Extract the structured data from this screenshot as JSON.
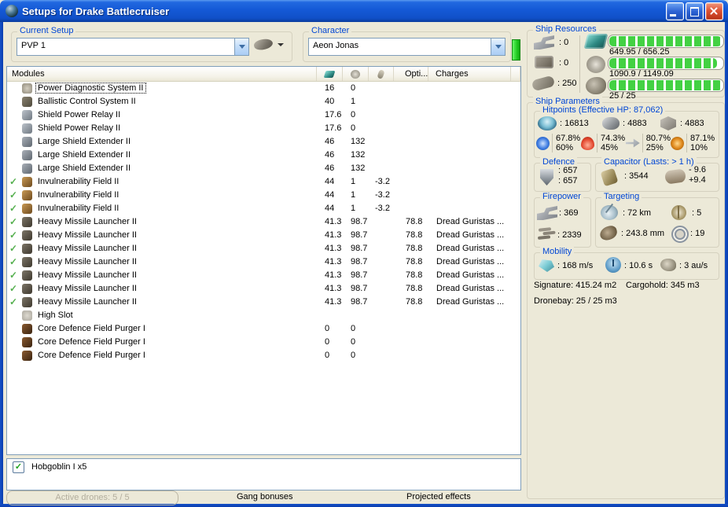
{
  "window": {
    "title": "Setups for Drake Battlecruiser"
  },
  "setup": {
    "label": "Current Setup",
    "value": "PVP 1"
  },
  "character": {
    "label": "Character",
    "value": "Aeon Jonas"
  },
  "ship_resources": {
    "label": "Ship Resources",
    "turret_hardpoints": ": 0",
    "launcher_hardpoints": ": 0",
    "calibration": ": 250",
    "bars": [
      {
        "name": "cpu",
        "text": "649.95 / 656.25",
        "pct": 99
      },
      {
        "name": "powergrid",
        "text": "1090.9 / 1149.09",
        "pct": 95
      },
      {
        "name": "drone-bandwidth",
        "text": "25 / 25",
        "pct": 100
      }
    ]
  },
  "modules": {
    "title": "Modules",
    "columns": {
      "opti": "Opti...",
      "charges": "Charges"
    },
    "rows": [
      {
        "active": false,
        "selected": true,
        "icon": "power-diagnostic",
        "name": "Power Diagnostic System II",
        "cpu": "16",
        "pg": "0",
        "cap": "",
        "opti": "",
        "charges": ""
      },
      {
        "active": false,
        "selected": false,
        "icon": "ballistic-control",
        "name": "Ballistic Control System II",
        "cpu": "40",
        "pg": "1",
        "cap": "",
        "opti": "",
        "charges": ""
      },
      {
        "active": false,
        "selected": false,
        "icon": "shield-power-relay",
        "name": "Shield Power Relay II",
        "cpu": "17.6",
        "pg": "0",
        "cap": "",
        "opti": "",
        "charges": ""
      },
      {
        "active": false,
        "selected": false,
        "icon": "shield-power-relay",
        "name": "Shield Power Relay II",
        "cpu": "17.6",
        "pg": "0",
        "cap": "",
        "opti": "",
        "charges": ""
      },
      {
        "active": false,
        "selected": false,
        "icon": "shield-extender",
        "name": "Large Shield Extender II",
        "cpu": "46",
        "pg": "132",
        "cap": "",
        "opti": "",
        "charges": ""
      },
      {
        "active": false,
        "selected": false,
        "icon": "shield-extender",
        "name": "Large Shield Extender II",
        "cpu": "46",
        "pg": "132",
        "cap": "",
        "opti": "",
        "charges": ""
      },
      {
        "active": false,
        "selected": false,
        "icon": "shield-extender",
        "name": "Large Shield Extender II",
        "cpu": "46",
        "pg": "132",
        "cap": "",
        "opti": "",
        "charges": ""
      },
      {
        "active": true,
        "selected": false,
        "icon": "invulnerability",
        "name": "Invulnerability Field II",
        "cpu": "44",
        "pg": "1",
        "cap": "-3.2",
        "opti": "",
        "charges": ""
      },
      {
        "active": true,
        "selected": false,
        "icon": "invulnerability",
        "name": "Invulnerability Field II",
        "cpu": "44",
        "pg": "1",
        "cap": "-3.2",
        "opti": "",
        "charges": ""
      },
      {
        "active": true,
        "selected": false,
        "icon": "invulnerability",
        "name": "Invulnerability Field II",
        "cpu": "44",
        "pg": "1",
        "cap": "-3.2",
        "opti": "",
        "charges": ""
      },
      {
        "active": true,
        "selected": false,
        "icon": "missile-launcher",
        "name": "Heavy Missile Launcher II",
        "cpu": "41.3",
        "pg": "98.7",
        "cap": "",
        "opti": "78.8",
        "charges": "Dread Guristas ..."
      },
      {
        "active": true,
        "selected": false,
        "icon": "missile-launcher",
        "name": "Heavy Missile Launcher II",
        "cpu": "41.3",
        "pg": "98.7",
        "cap": "",
        "opti": "78.8",
        "charges": "Dread Guristas ..."
      },
      {
        "active": true,
        "selected": false,
        "icon": "missile-launcher",
        "name": "Heavy Missile Launcher II",
        "cpu": "41.3",
        "pg": "98.7",
        "cap": "",
        "opti": "78.8",
        "charges": "Dread Guristas ..."
      },
      {
        "active": true,
        "selected": false,
        "icon": "missile-launcher",
        "name": "Heavy Missile Launcher II",
        "cpu": "41.3",
        "pg": "98.7",
        "cap": "",
        "opti": "78.8",
        "charges": "Dread Guristas ..."
      },
      {
        "active": true,
        "selected": false,
        "icon": "missile-launcher",
        "name": "Heavy Missile Launcher II",
        "cpu": "41.3",
        "pg": "98.7",
        "cap": "",
        "opti": "78.8",
        "charges": "Dread Guristas ..."
      },
      {
        "active": true,
        "selected": false,
        "icon": "missile-launcher",
        "name": "Heavy Missile Launcher II",
        "cpu": "41.3",
        "pg": "98.7",
        "cap": "",
        "opti": "78.8",
        "charges": "Dread Guristas ..."
      },
      {
        "active": true,
        "selected": false,
        "icon": "missile-launcher",
        "name": "Heavy Missile Launcher II",
        "cpu": "41.3",
        "pg": "98.7",
        "cap": "",
        "opti": "78.8",
        "charges": "Dread Guristas ..."
      },
      {
        "active": false,
        "selected": false,
        "icon": "high-slot",
        "name": "High Slot",
        "cpu": "",
        "pg": "",
        "cap": "",
        "opti": "",
        "charges": ""
      },
      {
        "active": false,
        "selected": false,
        "icon": "field-purger",
        "name": "Core Defence Field Purger I",
        "cpu": "0",
        "pg": "0",
        "cap": "",
        "opti": "",
        "charges": ""
      },
      {
        "active": false,
        "selected": false,
        "icon": "field-purger",
        "name": "Core Defence Field Purger I",
        "cpu": "0",
        "pg": "0",
        "cap": "",
        "opti": "",
        "charges": ""
      },
      {
        "active": false,
        "selected": false,
        "icon": "field-purger",
        "name": "Core Defence Field Purger I",
        "cpu": "0",
        "pg": "0",
        "cap": "",
        "opti": "",
        "charges": ""
      }
    ]
  },
  "drones": {
    "items": [
      {
        "name": "Hobgoblin I x5",
        "checked": true
      }
    ]
  },
  "status_bar": {
    "active_drones": "Active drones: 5 / 5",
    "gang_bonuses": "Gang bonuses",
    "projected_effects": "Projected effects"
  },
  "ship_parameters": {
    "label": "Ship Parameters",
    "hitpoints": {
      "label": "Hitpoints (Effective HP: 87,062)",
      "shield": ": 16813",
      "armor": ": 4883",
      "hull": ": 4883",
      "resists": [
        {
          "type": "em",
          "shield": "67.8%",
          "armor": "60%"
        },
        {
          "type": "thermal",
          "shield": "74.3%",
          "armor": "45%"
        },
        {
          "type": "kinetic",
          "shield": "80.7%",
          "armor": "25%"
        },
        {
          "type": "explosive",
          "shield": "87.1%",
          "armor": "10%"
        }
      ]
    },
    "defence": {
      "label": "Defence",
      "line1": ": 657",
      "line2": ": 657"
    },
    "capacitor": {
      "label": "Capacitor (Lasts: > 1 h)",
      "amount": ": 3544",
      "peak_minus": "- 9.6",
      "peak_plus": "+9.4"
    },
    "firepower": {
      "label": "Firepower",
      "dps": ": 369",
      "volley": ": 2339"
    },
    "targeting": {
      "label": "Targeting",
      "range": ": 72 km",
      "scan_resolution": ": 243.8 mm",
      "max_targets": ": 5",
      "sensor_strength": ": 19"
    },
    "mobility": {
      "label": "Mobility",
      "speed": ": 168 m/s",
      "align_time": ": 10.6 s",
      "warp_speed": ": 3 au/s"
    },
    "signature": "Signature: 415.24 m2",
    "cargohold": "Cargohold: 345 m3",
    "dronebay": "Dronebay: 25 / 25 m3"
  },
  "colors": {
    "accent_blue": "#0046D5",
    "bar_green": "#43D143",
    "titlebar_blue": "#1459D6"
  }
}
